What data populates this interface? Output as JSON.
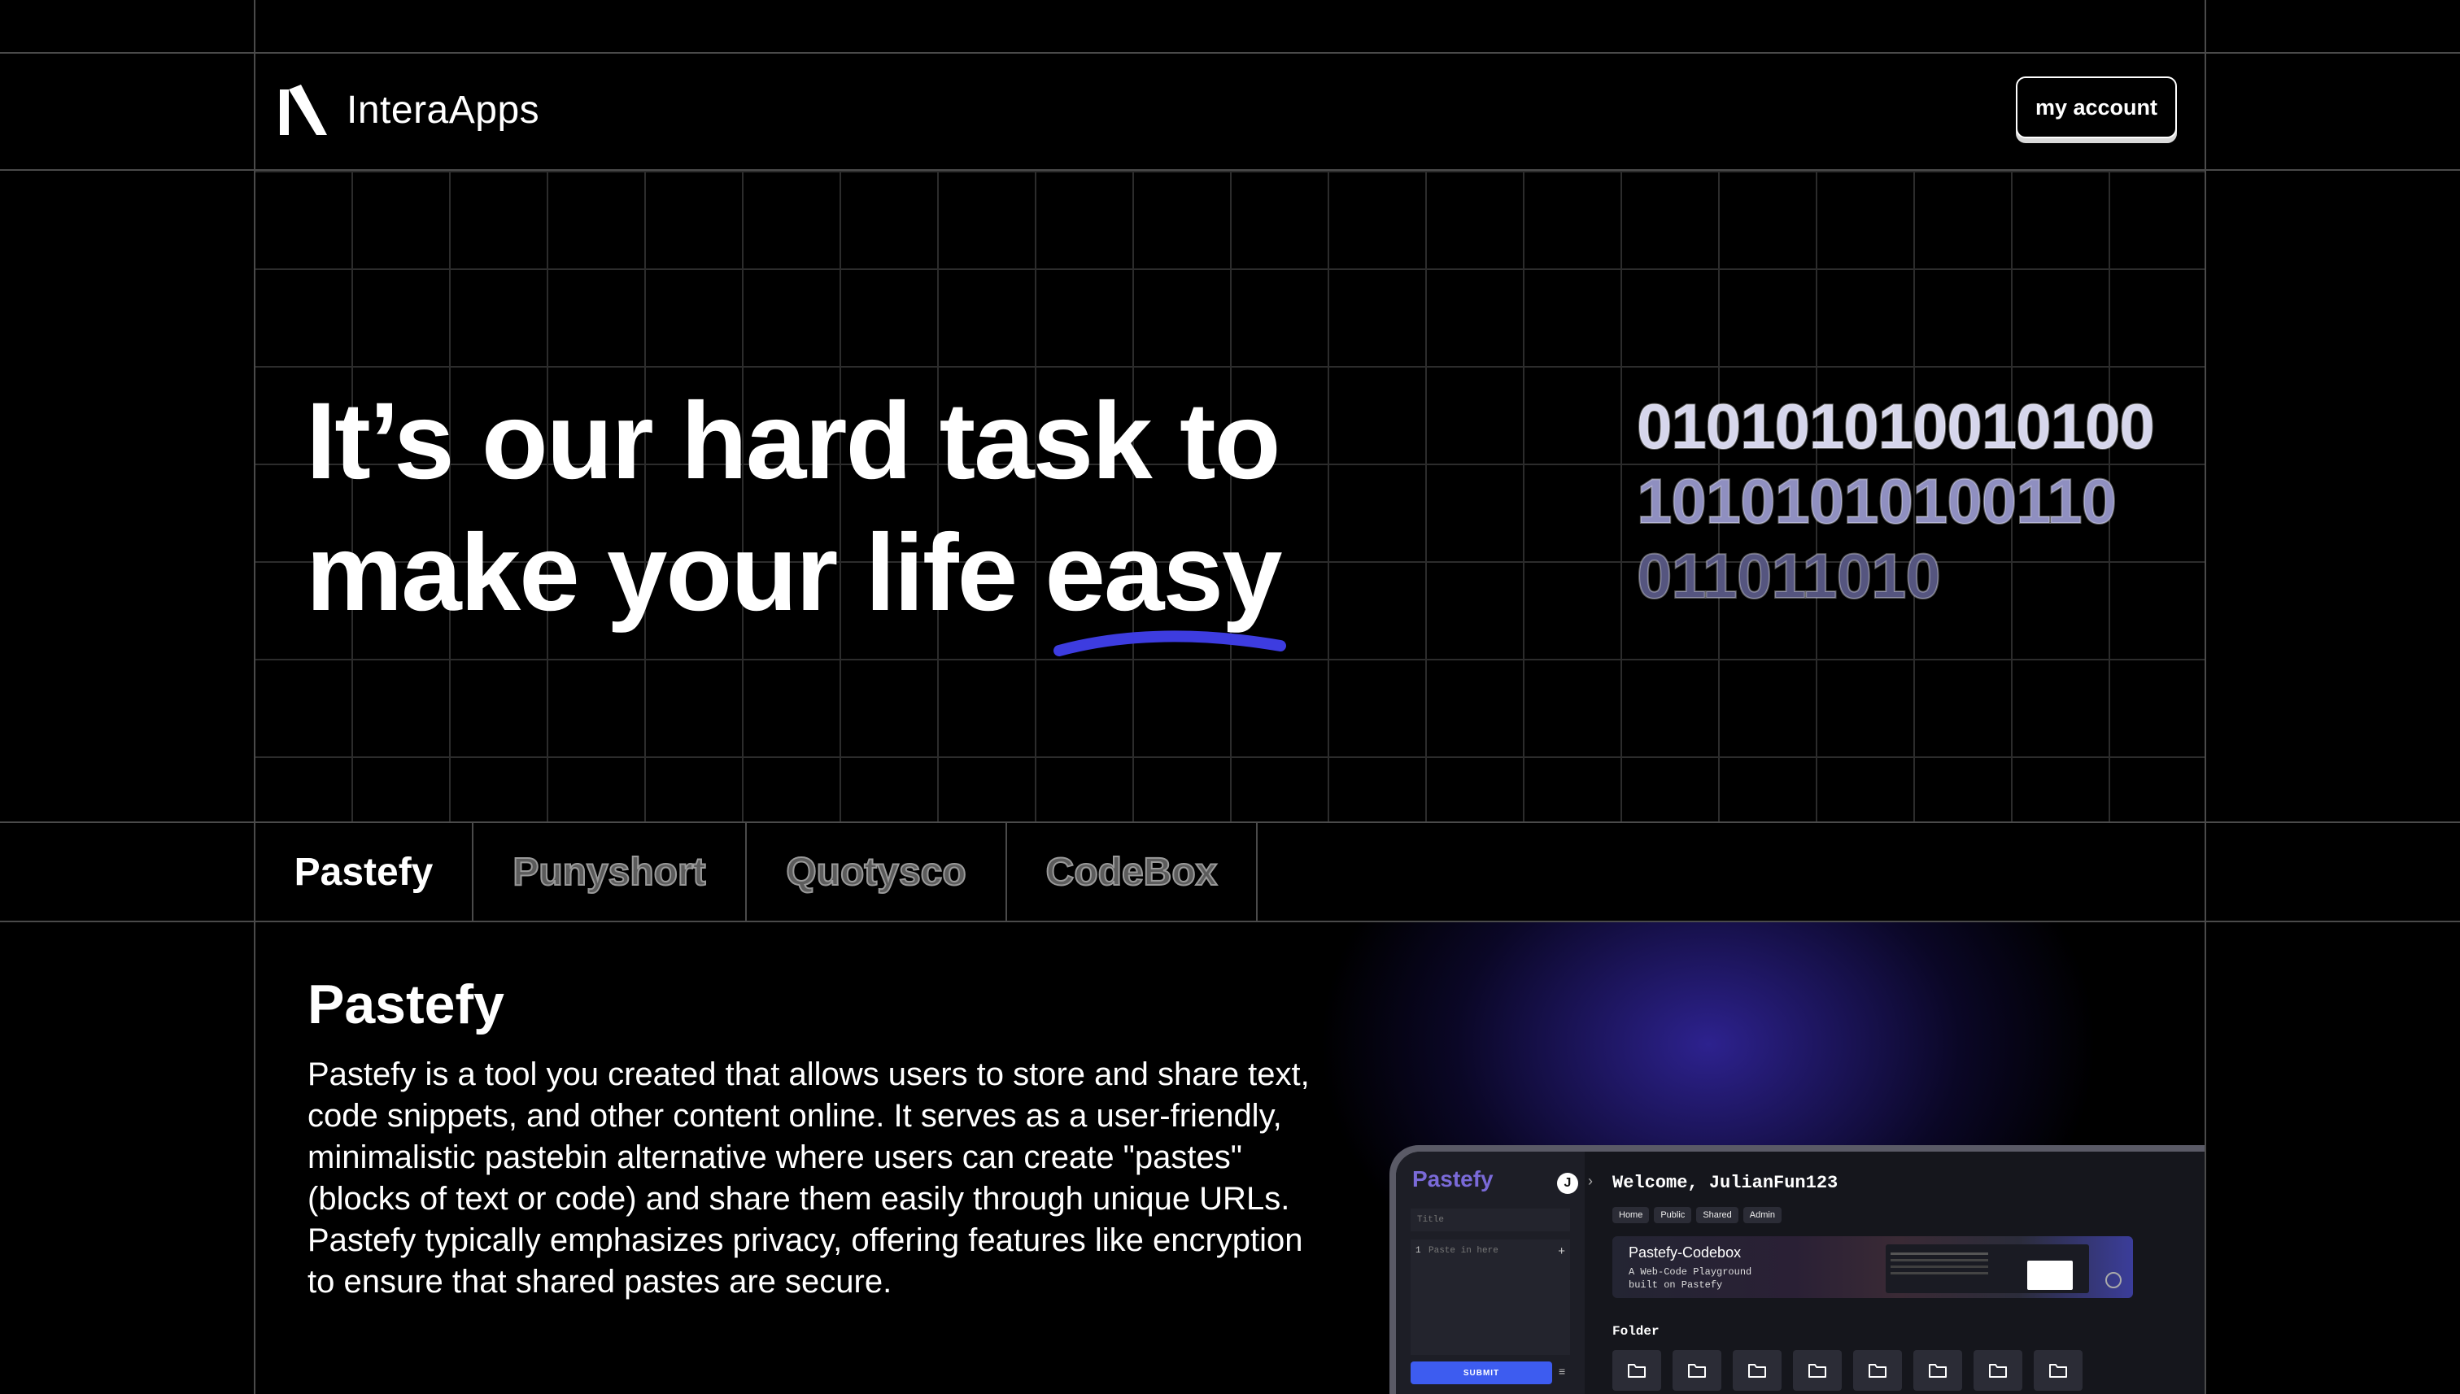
{
  "header": {
    "logo_text": "InteraApps",
    "account_button": "my account"
  },
  "hero": {
    "headline_line1": "It’s our hard task to",
    "headline_line2_prefix": "make your life ",
    "headline_emphasis": "easy",
    "accent_color": "#3d3ce0",
    "binary_lines": [
      "010101010010100",
      "10101010100110",
      "011011010"
    ]
  },
  "tabs": [
    {
      "label": "Pastefy",
      "active": true
    },
    {
      "label": "Punyshort",
      "active": false
    },
    {
      "label": "Quotysco",
      "active": false
    },
    {
      "label": "CodeBox",
      "active": false
    }
  ],
  "section": {
    "title": "Pastefy",
    "description": "Pastefy is a tool you created that allows users to store and share text, code snippets, and other content online. It serves as a user-friendly, minimalistic pastebin alternative where users can create \"pastes\" (blocks of text or code) and share them easily through unique URLs. Pastefy typically emphasizes privacy, offering features like encryption to ensure that shared pastes are secure."
  },
  "mockup": {
    "brand": "Pastefy",
    "avatar_letter": "J",
    "title_placeholder": "Title",
    "line_number": "1",
    "paste_placeholder": "Paste in here",
    "submit_label": "SUBMIT",
    "welcome": "Welcome, JulianFun123",
    "pills": [
      "Home",
      "Public",
      "Shared",
      "Admin"
    ],
    "banner_title": "Pastefy-Codebox",
    "banner_subtitle": "A Web-Code Playground\nbuilt on Pastefy",
    "folder_label": "Folder",
    "folder_count": 8
  }
}
